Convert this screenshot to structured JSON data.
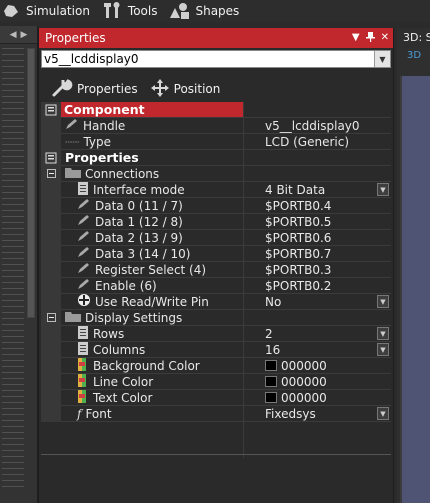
{
  "toolbar": {
    "simulation_label": "Simulation",
    "tools_label": "Tools",
    "shapes_label": "Shapes"
  },
  "panel": {
    "title": "Properties",
    "title_buttons": [
      "▼",
      "📌",
      "✕"
    ],
    "object_selector_value": "v5__lcddisplay0",
    "tab_properties": "Properties",
    "tab_position": "Position"
  },
  "component": {
    "section_label": "Component",
    "handle_label": "Handle",
    "handle_value": "v5__lcddisplay0",
    "type_label": "Type",
    "type_value": "LCD (Generic)"
  },
  "properties": {
    "section_label": "Properties",
    "connections": {
      "label": "Connections",
      "rows": [
        {
          "label": "Interface mode",
          "value": "4 Bit Data",
          "dropdown": true
        },
        {
          "label": "Data 0 (11 / 7)",
          "value": "$PORTB0.4",
          "dropdown": false
        },
        {
          "label": "Data 1 (12 / 8)",
          "value": "$PORTB0.5",
          "dropdown": false
        },
        {
          "label": "Data 2 (13 / 9)",
          "value": "$PORTB0.6",
          "dropdown": false
        },
        {
          "label": "Data 3 (14 / 10)",
          "value": "$PORTB0.7",
          "dropdown": false
        },
        {
          "label": "Register Select (4)",
          "value": "$PORTB0.3",
          "dropdown": false
        },
        {
          "label": "Enable (6)",
          "value": "$PORTB0.2",
          "dropdown": false
        },
        {
          "label": "Use Read/Write Pin",
          "value": "No",
          "dropdown": true
        }
      ]
    },
    "display": {
      "label": "Display Settings",
      "rows": [
        {
          "label": "Rows",
          "value": "2",
          "dropdown": true
        },
        {
          "label": "Columns",
          "value": "16",
          "dropdown": true
        },
        {
          "label": "Background Color",
          "value": "000000",
          "color": "#000000"
        },
        {
          "label": "Line Color",
          "value": "000000",
          "color": "#000000"
        },
        {
          "label": "Text Color",
          "value": "000000",
          "color": "#000000"
        },
        {
          "label": "Font",
          "value": "Fixedsys",
          "dropdown": true
        }
      ]
    }
  },
  "right_panel": {
    "title": "3D: S",
    "sub_tab": "3D"
  },
  "colors": {
    "accent": "#c0282d",
    "background": "#2a2a2a",
    "viewport": "#4f5474"
  }
}
